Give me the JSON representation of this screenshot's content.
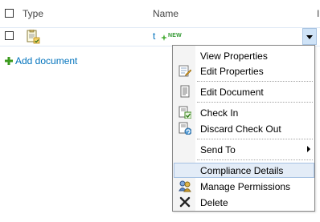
{
  "header": {
    "type_label": "Type",
    "name_label": "Name",
    "extra_label": "I"
  },
  "document": {
    "title": "t",
    "new_badge": "NEW"
  },
  "add_document": {
    "label": "Add document",
    "icon": "plus-icon"
  },
  "context_menu": {
    "items": [
      {
        "label": "View Properties",
        "icon": null
      },
      {
        "label": "Edit Properties",
        "icon": "edit-properties-icon"
      },
      {
        "label": "Edit Document",
        "icon": "document-icon"
      },
      {
        "label": "Check In",
        "icon": "check-in-icon"
      },
      {
        "label": "Discard Check Out",
        "icon": "discard-check-out-icon"
      },
      {
        "label": "Send To",
        "icon": null,
        "has_submenu": true
      },
      {
        "label": "Compliance Details",
        "icon": null,
        "highlighted": true
      },
      {
        "label": "Manage Permissions",
        "icon": "manage-permissions-icon"
      },
      {
        "label": "Delete",
        "icon": "delete-x-icon"
      }
    ]
  },
  "colors": {
    "link": "#0072bc",
    "highlight_bg": "#e3ecf7",
    "highlight_border": "#a7c2e3",
    "new_badge": "#339933"
  }
}
